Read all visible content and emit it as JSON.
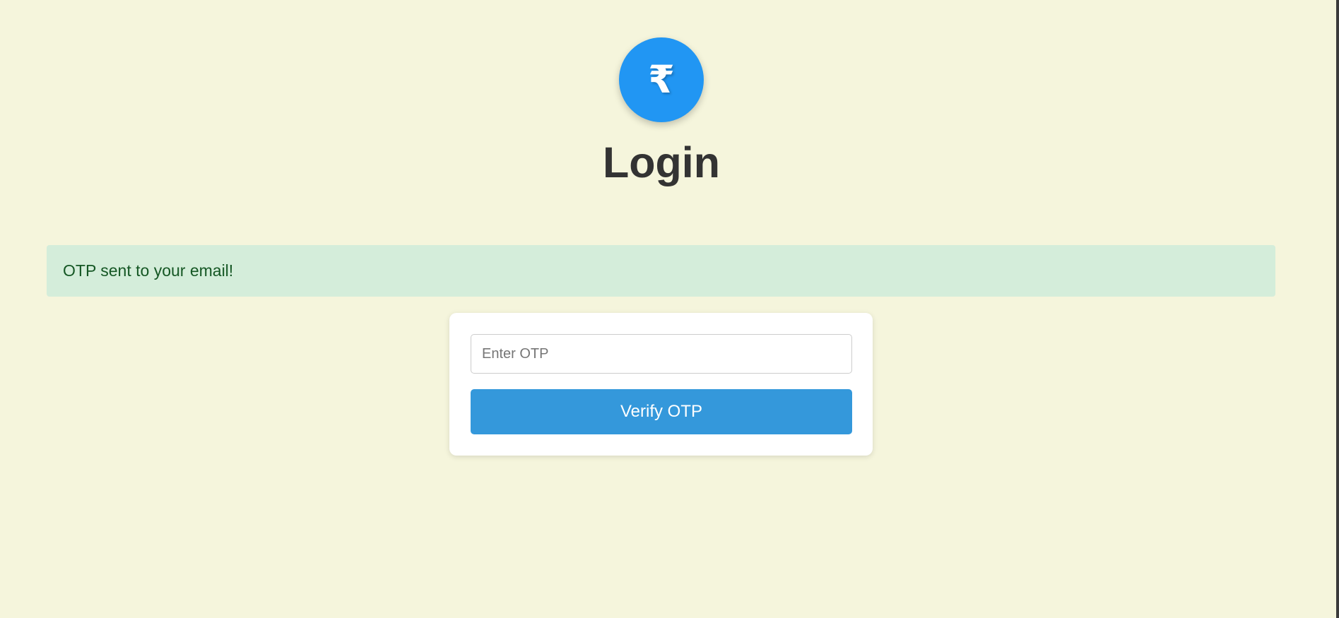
{
  "logo": {
    "symbol": "₹",
    "icon": "rupee-icon",
    "color": "#2196f3"
  },
  "page": {
    "title": "Login"
  },
  "alert": {
    "message": "OTP sent to your email!",
    "background": "#d4edda",
    "text_color": "#155724"
  },
  "form": {
    "otp_placeholder": "Enter OTP",
    "otp_value": "",
    "verify_label": "Verify OTP",
    "button_color": "#3498db"
  },
  "theme": {
    "background": "#f5f5dc"
  }
}
